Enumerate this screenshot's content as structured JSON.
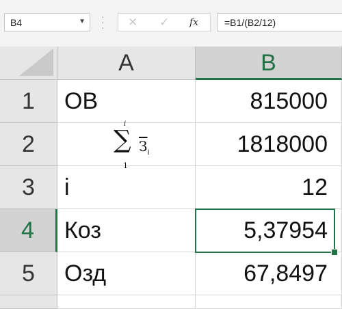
{
  "name_box": {
    "value": "B4"
  },
  "formula_bar": {
    "cancel_glyph": "✕",
    "enter_glyph": "✓",
    "function_label": "fx",
    "formula": "=B1/(B2/12)"
  },
  "columns": [
    "A",
    "B"
  ],
  "rows": [
    {
      "num": "1",
      "a": "ОВ",
      "b": "815000"
    },
    {
      "num": "2",
      "a": "",
      "b": "1818000"
    },
    {
      "num": "3",
      "a": "i",
      "b": "12"
    },
    {
      "num": "4",
      "a": "Коз",
      "b": "5,37954"
    },
    {
      "num": "5",
      "a": "Озд",
      "b": "67,8497"
    }
  ],
  "sum_formula": {
    "symbol": "∑",
    "upper": "i",
    "lower": "1",
    "term": "З",
    "subscript": "i"
  },
  "selection": {
    "cell": "B4",
    "accent": "#217346"
  }
}
